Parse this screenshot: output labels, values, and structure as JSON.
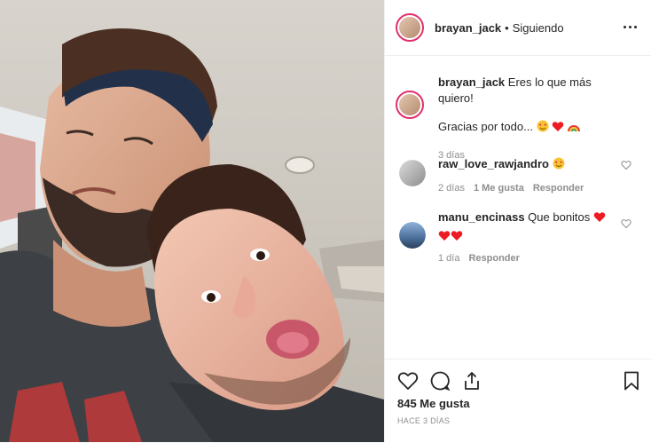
{
  "post": {
    "username": "brayan_jack",
    "separator": "•",
    "follow_status": "Siguiendo"
  },
  "caption": {
    "username": "brayan_jack",
    "text_line1": "Eres lo que más quiero!",
    "text_line2": "Gracias por todo...",
    "age": "3 días"
  },
  "comments": [
    {
      "username": "raw_love_rawjandro",
      "text": "",
      "age": "2 días",
      "likes": "1 Me gusta",
      "reply": "Responder"
    },
    {
      "username": "manu_encinass",
      "text": "Que bonitos",
      "age": "1 día",
      "reply": "Responder"
    }
  ],
  "footer": {
    "likes": "845 Me gusta",
    "time": "HACE 3 DÍAS"
  },
  "colors": {
    "story_ring": "#e1306c",
    "heart_red": "#ed1c24",
    "muted": "#8e8e8e",
    "text": "#262626"
  }
}
